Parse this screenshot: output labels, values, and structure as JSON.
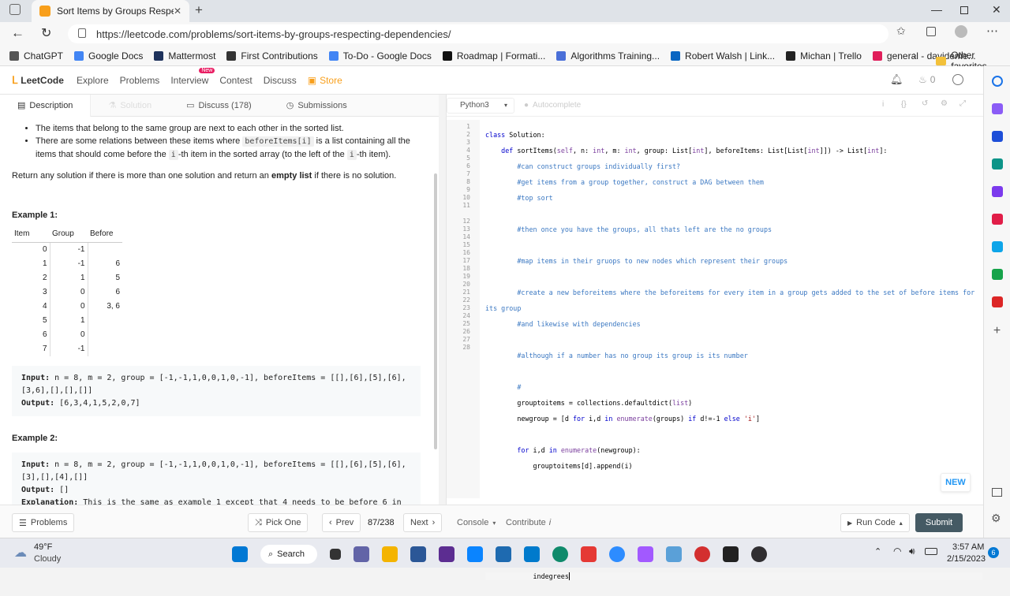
{
  "browser": {
    "tab_title": "Sort Items by Groups Respecting",
    "url": "https://leetcode.com/problems/sort-items-by-groups-respecting-dependencies/",
    "bookmarks": [
      {
        "label": "ChatGPT",
        "color": "#555555"
      },
      {
        "label": "Google Docs",
        "color": "#4285f4"
      },
      {
        "label": "Mattermost",
        "color": "#1e325c"
      },
      {
        "label": "First Contributions",
        "color": "#333333"
      },
      {
        "label": "To-Do - Google Docs",
        "color": "#4285f4"
      },
      {
        "label": "Roadmap | Formati...",
        "color": "#111111"
      },
      {
        "label": "Algorithms Training...",
        "color": "#4a6fd8"
      },
      {
        "label": "Robert Walsh | Link...",
        "color": "#0a66c2"
      },
      {
        "label": "Michan | Trello",
        "color": "#222222"
      },
      {
        "label": "general - davideme...",
        "color": "#e01e5a"
      }
    ],
    "other_favorites": "Other favorites"
  },
  "lcnav": {
    "logo": "LeetCode",
    "items": [
      "Explore",
      "Problems",
      "Interview",
      "Contest",
      "Discuss"
    ],
    "new_badge": "New",
    "store": "Store",
    "streak": "0"
  },
  "left": {
    "tabs": [
      "Description",
      "Solution",
      "Discuss (178)",
      "Submissions"
    ],
    "bullet1": "The items that belong to the same group are next to each other in the sorted list.",
    "bullet2_a": "There are some relations between these items where",
    "bullet2_code": "beforeItems[i]",
    "bullet2_b": "is a list containing all the items that should come before the",
    "bullet2_code2": "i",
    "bullet2_c": "-th item in the sorted array (to the left of the",
    "bullet2_code3": "i",
    "bullet2_d": "-th item).",
    "return_a": "Return any solution if there is more than one solution and return an",
    "return_b": "empty list",
    "return_c": "if there is no solution.",
    "ex1_title": "Example 1:",
    "table_headers": [
      "Item",
      "Group",
      "Before"
    ],
    "table_rows": [
      [
        "0",
        "-1",
        ""
      ],
      [
        "1",
        "-1",
        "6"
      ],
      [
        "2",
        "1",
        "5"
      ],
      [
        "3",
        "0",
        "6"
      ],
      [
        "4",
        "0",
        "3, 6"
      ],
      [
        "5",
        "1",
        ""
      ],
      [
        "6",
        "0",
        ""
      ],
      [
        "7",
        "-1",
        ""
      ]
    ],
    "ex1_input_label": "Input:",
    "ex1_input": " n = 8, m = 2, group = [-1,-1,1,0,0,1,0,-1], beforeItems = [[],[6],[5],[6],[3,6],[],[],[]]",
    "ex1_output_label": "Output:",
    "ex1_output": " [6,3,4,1,5,2,0,7]",
    "ex2_title": "Example 2:",
    "ex2_input_label": "Input:",
    "ex2_input": " n = 8, m = 2, group = [-1,-1,1,0,0,1,0,-1], beforeItems = [[],[6],[5],[6],[3],[],[4],[]]",
    "ex2_output_label": "Output:",
    "ex2_output": " []",
    "ex2_expl_label": "Explanation:",
    "ex2_expl": " This is the same as example 1 except that 4 needs to be before 6 in the sorted list."
  },
  "editor": {
    "language": "Python3",
    "autocomplete": "Autocomplete",
    "line_numbers": [
      "1",
      "2",
      "3",
      "4",
      "5",
      "6",
      "7",
      "8",
      "9",
      "10",
      "11",
      "",
      "12",
      "13",
      "14",
      "15",
      "16",
      "17",
      "18",
      "19",
      "20",
      "21",
      "22",
      "23",
      "24",
      "25",
      "26",
      "27",
      "28"
    ],
    "new_label": "NEW"
  },
  "bottom": {
    "problems": "Problems",
    "pick_one": "Pick One",
    "prev": "Prev",
    "counter": "87/238",
    "next": "Next",
    "console": "Console",
    "contribute": "Contribute",
    "run_code": "Run Code",
    "submit": "Submit"
  },
  "taskbar": {
    "temp": "49°F",
    "weather": "Cloudy",
    "search": "Search",
    "time": "3:57 AM",
    "date": "2/15/2023",
    "notif": "6"
  }
}
